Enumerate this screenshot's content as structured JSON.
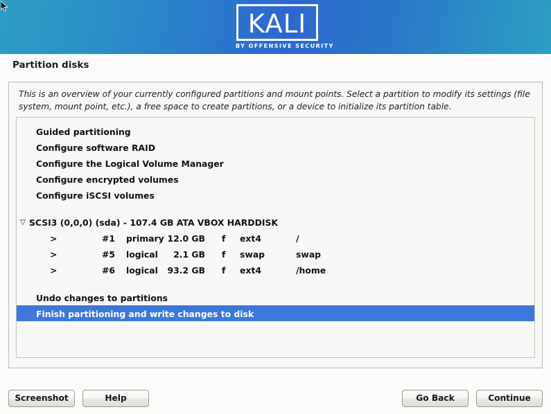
{
  "branding": {
    "logo_word": "KALI",
    "logo_subtitle": "BY OFFENSIVE SECURITY"
  },
  "page": {
    "title": "Partition disks",
    "intro": "This is an overview of your currently configured partitions and mount points. Select a partition to modify its settings (file system, mount point, etc.), a free space to create partitions, or a device to initialize its partition table."
  },
  "list": {
    "actions_top": [
      {
        "label": "Guided partitioning"
      },
      {
        "label": "Configure software RAID"
      },
      {
        "label": "Configure the Logical Volume Manager"
      },
      {
        "label": "Configure encrypted volumes"
      },
      {
        "label": "Configure iSCSI volumes"
      }
    ],
    "disk": {
      "expander": "▽",
      "label": "SCSI3 (0,0,0) (sda) - 107.4 GB ATA VBOX HARDDISK",
      "partitions": [
        {
          "arrow": ">",
          "number": "#1",
          "type": "primary",
          "size": "12.0 GB",
          "flag": "f",
          "filesystem": "ext4",
          "mount": "/"
        },
        {
          "arrow": ">",
          "number": "#5",
          "type": "logical",
          "size": "2.1 GB",
          "flag": "f",
          "filesystem": "swap",
          "mount": "swap"
        },
        {
          "arrow": ">",
          "number": "#6",
          "type": "logical",
          "size": "93.2 GB",
          "flag": "f",
          "filesystem": "ext4",
          "mount": "/home"
        }
      ]
    },
    "actions_bottom": [
      {
        "label": "Undo changes to partitions",
        "selected": false
      },
      {
        "label": "Finish partitioning and write changes to disk",
        "selected": true
      }
    ]
  },
  "footer": {
    "screenshot": "Screenshot",
    "help": "Help",
    "go_back": "Go Back",
    "continue": "Continue"
  },
  "colors": {
    "selection_blue": "#3c78da",
    "banner_left": "#2c9dc4",
    "banner_center": "#2c68cf"
  }
}
